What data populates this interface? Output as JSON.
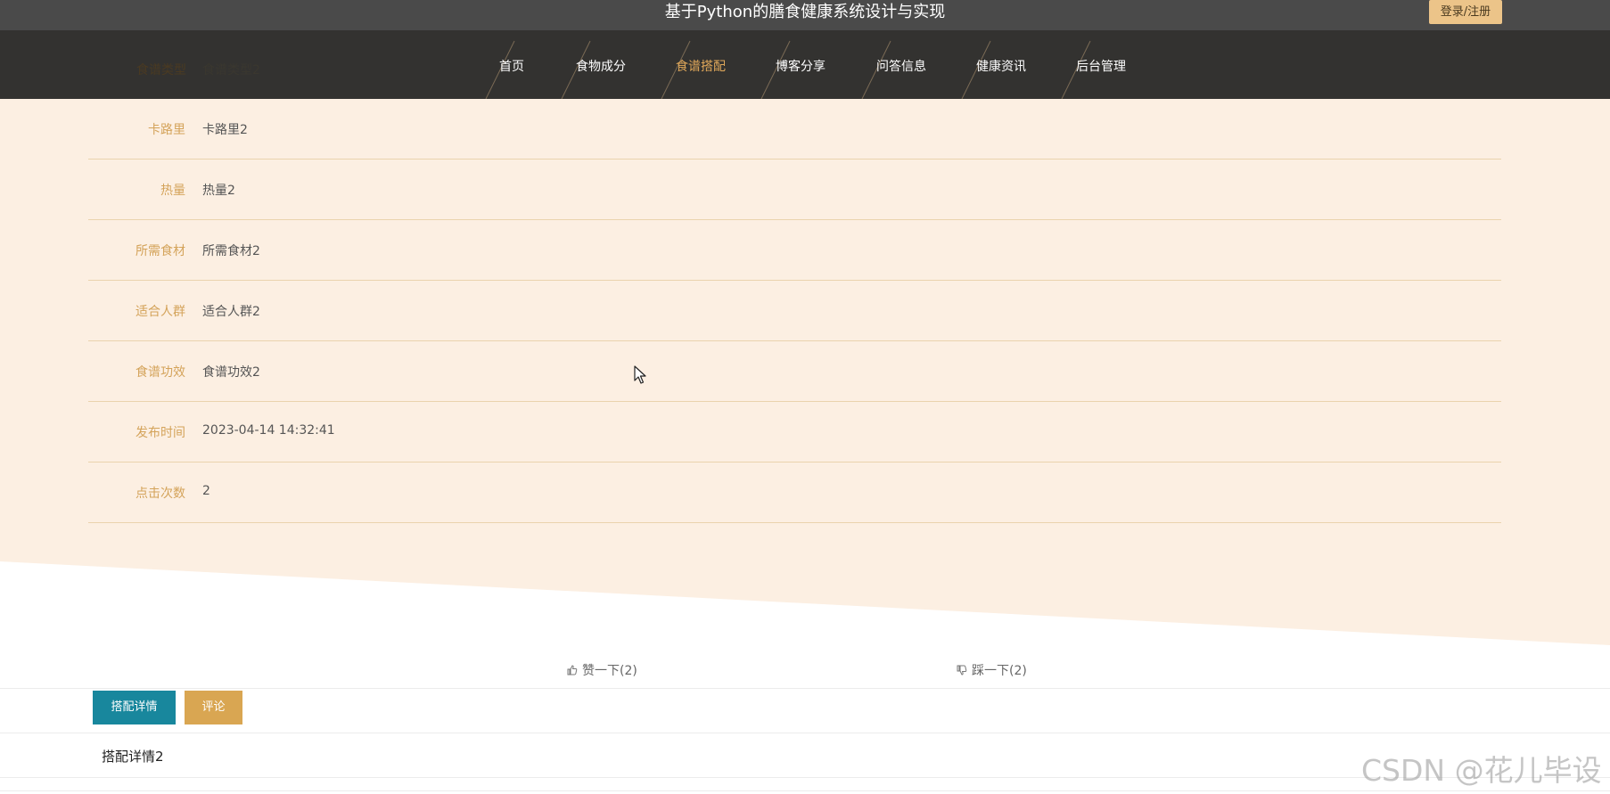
{
  "header": {
    "site_title": "基于Python的膳食健康系统设计与实现",
    "login_label": "登录/注册"
  },
  "nav": {
    "items": [
      {
        "label": "首页",
        "active": false
      },
      {
        "label": "食物成分",
        "active": false
      },
      {
        "label": "食谱搭配",
        "active": true
      },
      {
        "label": "博客分享",
        "active": false
      },
      {
        "label": "问答信息",
        "active": false
      },
      {
        "label": "健康资讯",
        "active": false
      },
      {
        "label": "后台管理",
        "active": false
      }
    ]
  },
  "details": {
    "partial_row": {
      "label": "食谱类型",
      "value": "食谱类型2"
    },
    "rows": [
      {
        "label": "卡路里",
        "value": "卡路里2"
      },
      {
        "label": "热量",
        "value": "热量2"
      },
      {
        "label": "所需食材",
        "value": "所需食材2"
      },
      {
        "label": "适合人群",
        "value": "适合人群2"
      },
      {
        "label": "食谱功效",
        "value": "食谱功效2"
      },
      {
        "label": "发布时间",
        "value": "2023-04-14 14:32:41"
      },
      {
        "label": "点击次数",
        "value": "2"
      }
    ]
  },
  "votes": {
    "like_label": "赞一下(2)",
    "dislike_label": "踩一下(2)"
  },
  "tabs": {
    "detail_label": "搭配详情",
    "comment_label": "评论",
    "content": "搭配详情2"
  },
  "watermark": "CSDN @花儿毕设",
  "colors": {
    "topbar": "#4a4a4a",
    "navbar": "#333230",
    "accent": "#e0a85a",
    "beige": "#fcefe2",
    "tab_detail": "#18879d",
    "tab_comment": "#d9a652"
  }
}
